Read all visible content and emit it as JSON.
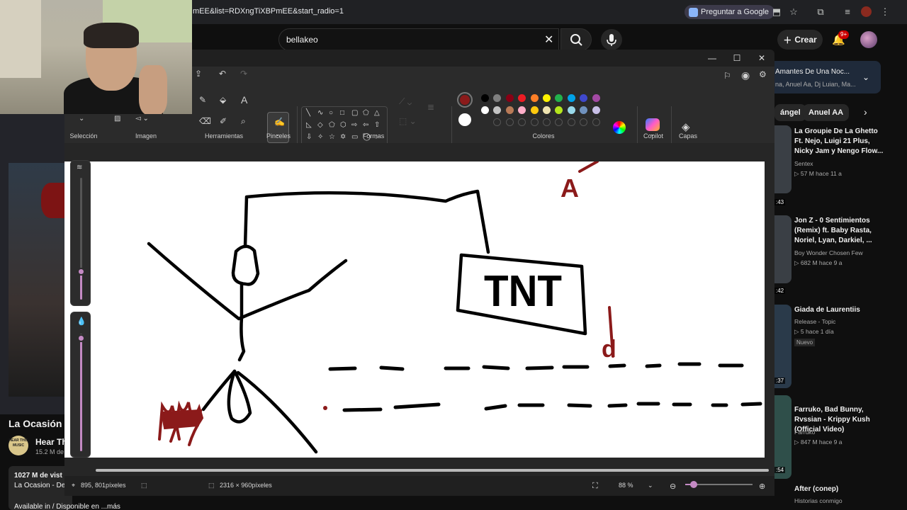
{
  "browser": {
    "url": "mEE&list=RDXngTiXBPmEE&start_radio=1",
    "ask_google": "Preguntar a Google"
  },
  "youtube": {
    "search_value": "bellakeo",
    "create_label": "Crear",
    "notif_count": "9+",
    "video": {
      "title": "La Ocasión",
      "channel_name": "Hear Th",
      "channel_logo_text": "HEAR THIS MUSIC",
      "subs": "15.2 M de",
      "views": "1027 M de vist",
      "desc": "La Ocasion - De",
      "more": "Available in / Disponible en ...más"
    },
    "mix": {
      "title": "Amantes De Una Noc...",
      "subtitle": "na, Anuel Aa, Dj Luian, Ma..."
    },
    "chips": [
      "ángel",
      "Anuel AA"
    ],
    "recommendations": [
      {
        "title": "La Groupie De La Ghetto Ft. Nejo, Luigi 21 Plus, Nicky Jam y Nengo Flow...",
        "channel": "Sentex",
        "meta": "▷ 57 M  hace 11 a",
        "time": ":43"
      },
      {
        "title": "Jon Z - 0 Sentimientos (Remix) ft. Baby Rasta, Noriel, Lyan, Darkiel, ...",
        "channel": "Boy Wonder Chosen Few",
        "meta": "▷ 682 M  hace 9 a",
        "time": ":42"
      },
      {
        "title": "Giada de Laurentiis",
        "channel": "Release - Topic",
        "meta": "▷ 5  hace 1 día",
        "badge": "Nuevo",
        "time": ":37"
      },
      {
        "title": "Farruko, Bad Bunny, Rvssian - Krippy Kush (Official Video)",
        "channel": "Farruko",
        "meta": "▷ 847 M  hace 9 a",
        "time": ":54"
      },
      {
        "title": "After (conep)",
        "channel": "Historias conmigo",
        "meta": "",
        "time": ""
      }
    ]
  },
  "paint": {
    "groups": {
      "selection": "Selección",
      "image": "Imagen",
      "tools": "Herramientas",
      "brushes": "Pinceles",
      "shapes": "Formas",
      "colors": "Colores",
      "copilot": "Copilot",
      "layers": "Capas"
    },
    "colors": {
      "primary": "#8b1a1a",
      "secondary": "#ffffff",
      "row1": [
        "#000000",
        "#7f7f7f",
        "#880015",
        "#ed1c24",
        "#ff7f27",
        "#fff200",
        "#22b14c",
        "#00a2e8",
        "#3f48cc",
        "#a349a4"
      ],
      "row2": [
        "#ffffff",
        "#c3c3c3",
        "#b97a57",
        "#ffaec9",
        "#ffc90e",
        "#efe4b0",
        "#b5e61d",
        "#99d9ea",
        "#7092be",
        "#c8bfe7"
      ]
    },
    "drawing": {
      "sign_text": "TNT",
      "letter_a": "A",
      "letter_d": "d"
    },
    "status": {
      "cursor_pos": "895, 801píxeles",
      "canvas_size": "2316 × 960píxeles",
      "zoom": "88 %"
    }
  }
}
